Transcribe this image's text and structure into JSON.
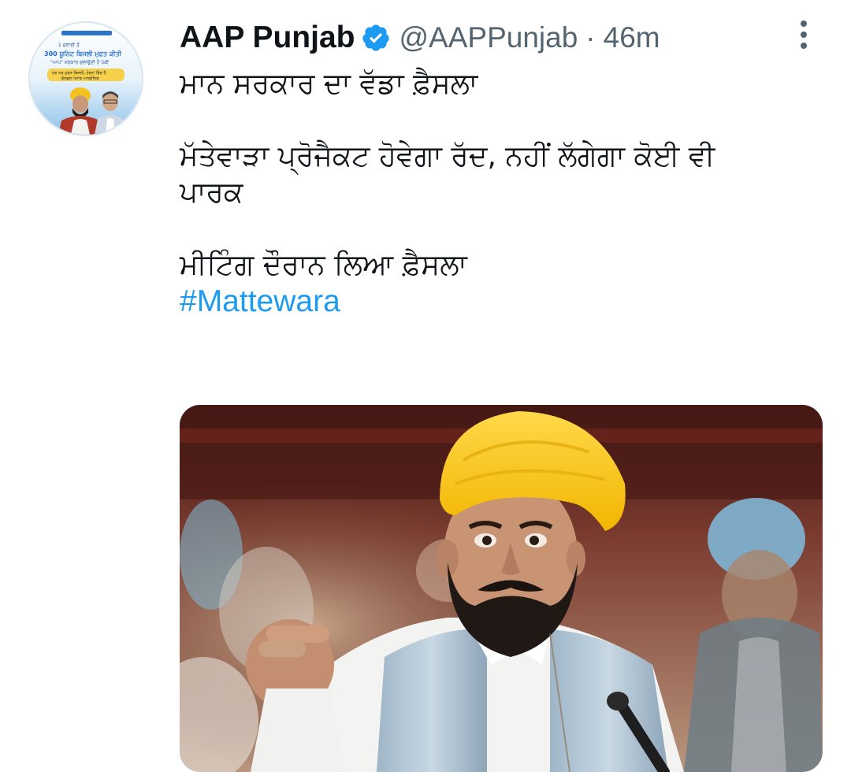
{
  "tweet": {
    "display_name": "AAP Punjab",
    "handle": "@AAPPunjab",
    "separator": "·",
    "timestamp": "46m",
    "text_lines": {
      "line1": "ਮਾਨ ਸਰਕਾਰ ਦਾ ਵੱਡਾ ਫ਼ੈਸਲਾ",
      "line2": "ਮੱਤੇਵਾੜਾ ਪ੍ਰੋਜੈਕਟ ਹੋਵੇਗਾ ਰੱਦ, ਨਹੀਂ ਲੱਗੇਗਾ ਕੋਈ ਵੀ",
      "line3": "ਪਾਰਕ",
      "line4": "ਮੀਟਿੰਗ ਦੌਰਾਨ ਲਿਆ ਫ਼ੈਸਲਾ"
    },
    "hashtag": "#Mattewara"
  },
  "avatar": {
    "banner_line1": "1 ਜੁਲਾਈ ਤੋਂ",
    "banner_line2": "300 ਯੂਨਿਟ ਬਿਜਲੀ ਮੁਫ਼ਤ ਕੀਤੀ",
    "banner_line3": "\"ਆਪ\" ਸਰਕਾਰ ਚਲਾਉਣੀ ਹੈ ਪੱਕੀ",
    "banner_line4": "ਹਰ ਘਰ ਮੁਫ਼ਤ ਬਿਜਲੀ, ਹੋਰਨਾਂ ਵਿੱਚ ਹੈ",
    "banner_line5": "ਗੋਲਡਨ ਪੰਜਾਬ ਆਰਗੇਨਿਕ"
  },
  "icons": {
    "verified": "verified-badge-icon",
    "more": "more-vertical-icon"
  },
  "colors": {
    "link": "#1d9bf0",
    "secondary_text": "#536471",
    "primary_text": "#0f1419",
    "verified": "#1d9bf0"
  }
}
